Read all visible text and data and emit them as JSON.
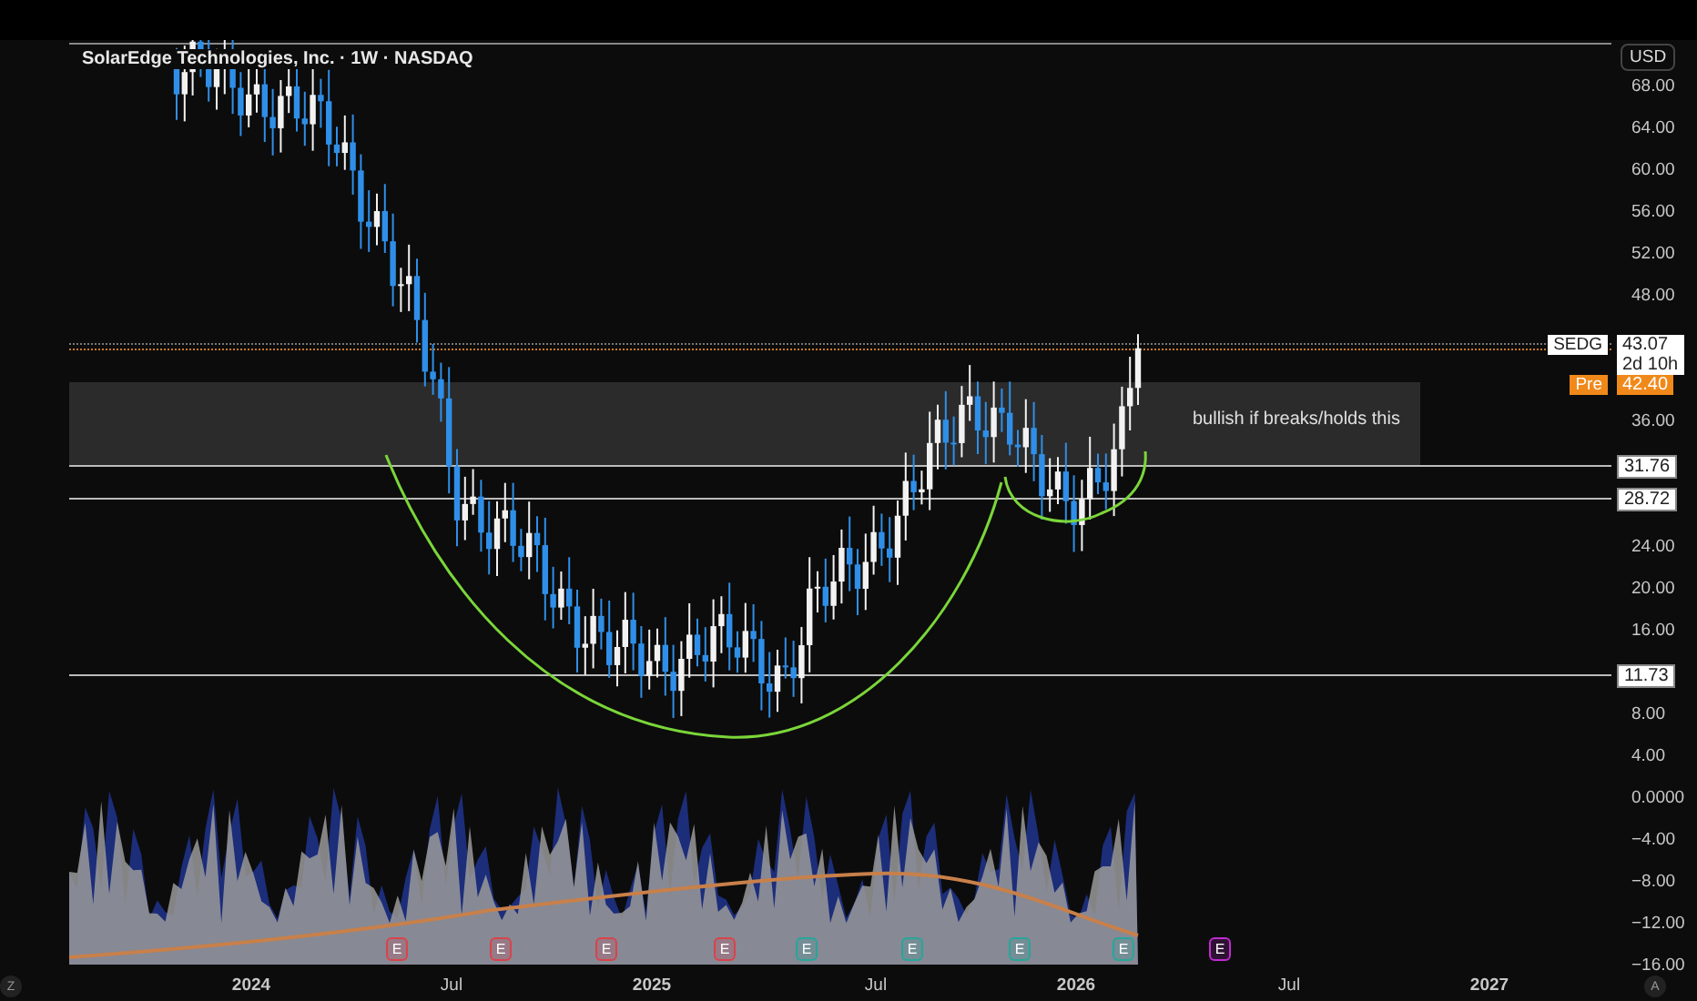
{
  "header": {
    "title": "SolarEdge Technologies, Inc. · 1W · NASDAQ"
  },
  "price_axis": {
    "currency": "USD",
    "ticks": [
      "68.00",
      "64.00",
      "60.00",
      "56.00",
      "52.00",
      "48.00",
      "36.00",
      "24.00",
      "20.00",
      "16.00",
      "8.00",
      "4.00",
      "0.0000",
      "−4.00",
      "−8.00",
      "−12.00",
      "−16.00"
    ]
  },
  "last_price": {
    "symbol": "SEDG",
    "price": "43.07",
    "countdown": "2d 10h"
  },
  "premarket": {
    "label": "Pre",
    "price": "42.40"
  },
  "levels": [
    {
      "price": "31.76"
    },
    {
      "price": "28.72"
    },
    {
      "price": "11.73"
    }
  ],
  "annotation": {
    "text": "bullish if breaks/holds this"
  },
  "time_axis": {
    "labels": [
      "2024",
      "Jul",
      "2025",
      "Jul",
      "2026",
      "Jul",
      "2027"
    ]
  },
  "earnings": [
    {
      "label": "E",
      "color": "#d9434a"
    },
    {
      "label": "E",
      "color": "#d9434a"
    },
    {
      "label": "E",
      "color": "#d9434a"
    },
    {
      "label": "E",
      "color": "#d9434a"
    },
    {
      "label": "E",
      "color": "#26a69a"
    },
    {
      "label": "E",
      "color": "#26a69a"
    },
    {
      "label": "E",
      "color": "#26a69a"
    },
    {
      "label": "E",
      "color": "#26a69a"
    },
    {
      "label": "E",
      "color": "#c02bd0"
    }
  ],
  "buttons": {
    "zoom": "Z",
    "auto": "A"
  }
}
